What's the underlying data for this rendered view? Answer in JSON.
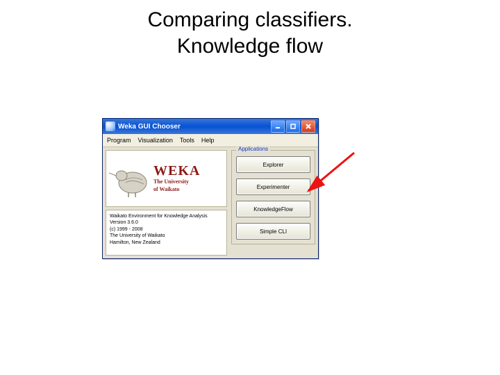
{
  "slide": {
    "title_line1": "Comparing classifiers.",
    "title_line2": "Knowledge flow"
  },
  "window": {
    "title": "Weka GUI Chooser",
    "menus": {
      "program": "Program",
      "visualization": "Visualization",
      "tools": "Tools",
      "help": "Help"
    },
    "brand": {
      "name": "WEKA",
      "sub1": "The University",
      "sub2": "of Waikato"
    },
    "about": {
      "line1": "Waikato Environment for Knowledge Analysis",
      "line2": "Version 3.6.0",
      "line3": "(c) 1999 - 2008",
      "line4": "The University of Waikato",
      "line5": "Hamilton, New Zealand"
    },
    "apps": {
      "legend": "Applications",
      "explorer": "Explorer",
      "experimenter": "Experimenter",
      "knowledgeflow": "KnowledgeFlow",
      "simplecli": "Simple CLI"
    }
  }
}
